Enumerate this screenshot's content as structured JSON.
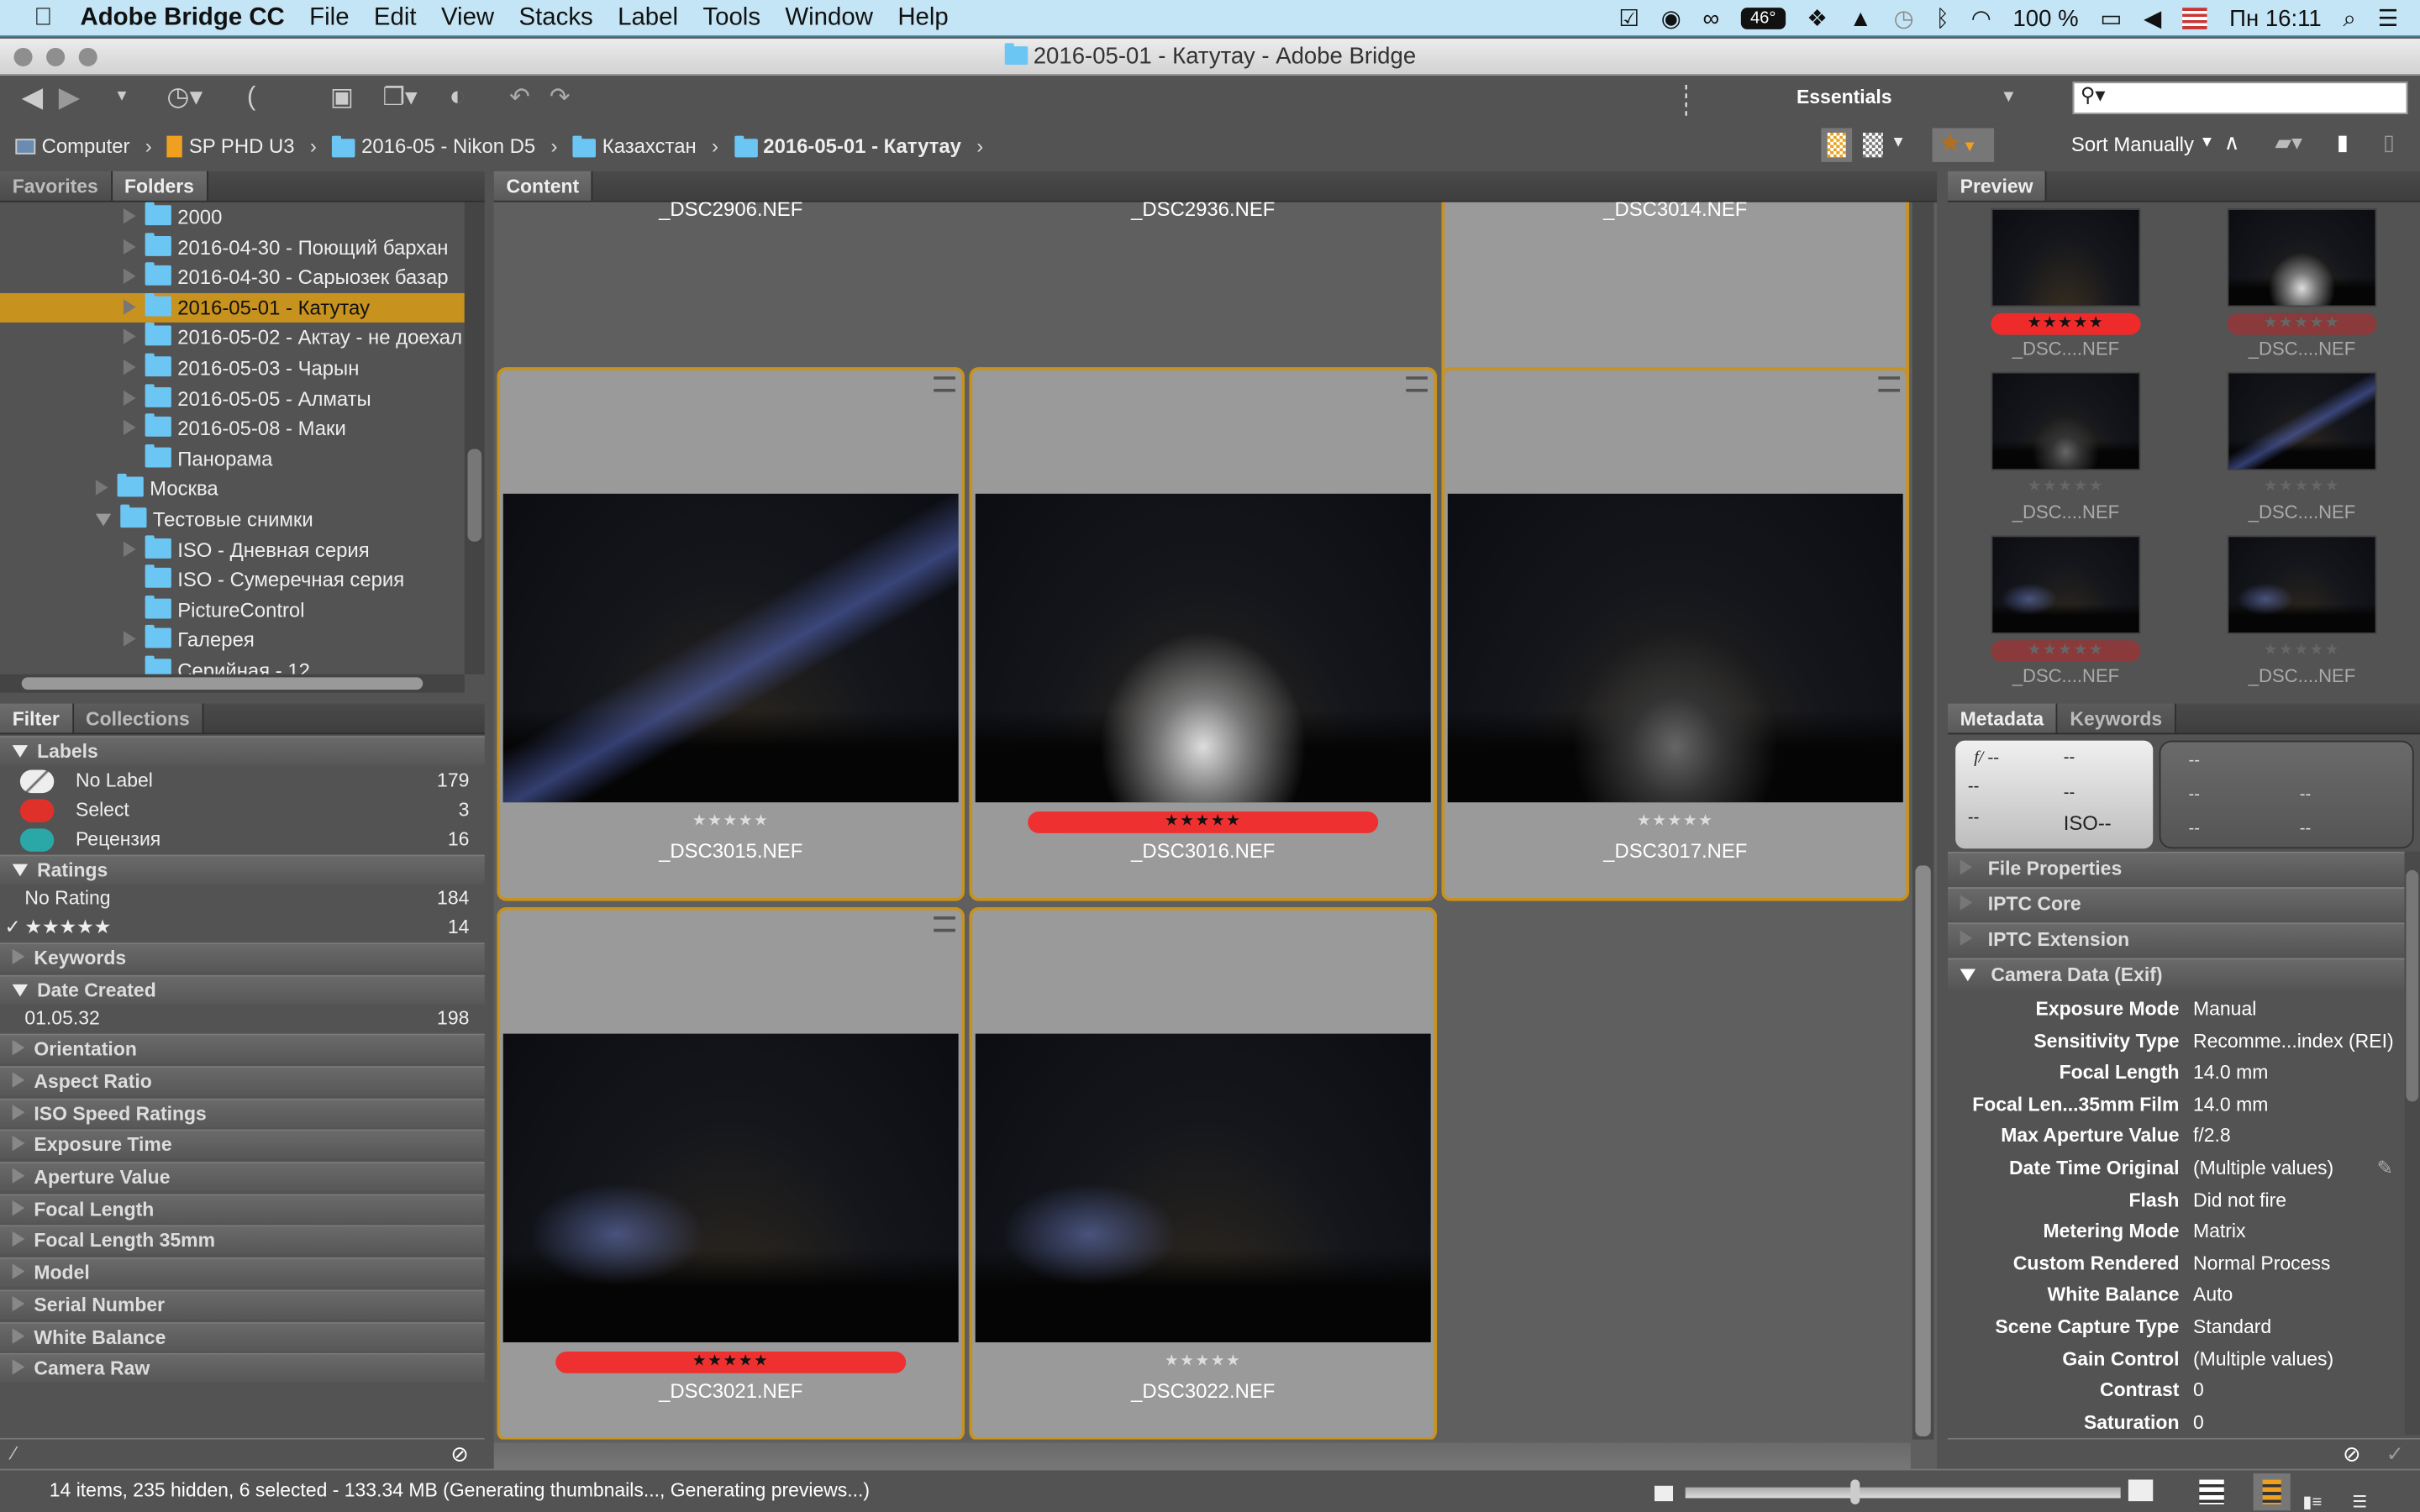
{
  "menubar": {
    "app": "Adobe Bridge CC",
    "items": [
      "File",
      "Edit",
      "View",
      "Stacks",
      "Label",
      "Tools",
      "Window",
      "Help"
    ],
    "temp": "46°",
    "battery": "100 %",
    "clock": "Пн 16:11"
  },
  "window": {
    "title": "2016-05-01 - Катутау - Adobe Bridge"
  },
  "toolbar": {
    "workspace": "Essentials",
    "search_placeholder": "",
    "sort": "Sort Manually"
  },
  "breadcrumb": [
    "Computer",
    "SP PHD U3",
    "2016-05 - Nikon D5",
    "Казахстан",
    "2016-05-01 - Катутау"
  ],
  "left": {
    "tabs": [
      "Favorites",
      "Folders"
    ],
    "folders": [
      {
        "label": "2000",
        "indent": 2,
        "arrow": "right"
      },
      {
        "label": "2016-04-30 - Поющий бархан",
        "indent": 2,
        "arrow": "right"
      },
      {
        "label": "2016-04-30 - Сарыозек базар",
        "indent": 2,
        "arrow": "right"
      },
      {
        "label": "2016-05-01 - Катутау",
        "indent": 2,
        "arrow": "right",
        "selected": true
      },
      {
        "label": "2016-05-02 - Актау - не доехал",
        "indent": 2,
        "arrow": "right"
      },
      {
        "label": "2016-05-03 - Чарын",
        "indent": 2,
        "arrow": "right"
      },
      {
        "label": "2016-05-05 - Алматы",
        "indent": 2,
        "arrow": "right"
      },
      {
        "label": "2016-05-08 - Маки",
        "indent": 2,
        "arrow": "right"
      },
      {
        "label": "Панорама",
        "indent": 2,
        "arrow": "none"
      },
      {
        "label": "Москва",
        "indent": 1,
        "arrow": "right"
      },
      {
        "label": "Тестовые снимки",
        "indent": 1,
        "arrow": "down"
      },
      {
        "label": "ISO - Дневная серия",
        "indent": 2,
        "arrow": "right"
      },
      {
        "label": "ISO - Сумеречная серия",
        "indent": 2,
        "arrow": "none"
      },
      {
        "label": "PictureControl",
        "indent": 2,
        "arrow": "none"
      },
      {
        "label": "Галерея",
        "indent": 2,
        "arrow": "right"
      },
      {
        "label": "Серийная - 12",
        "indent": 2,
        "arrow": "none"
      }
    ]
  },
  "filter": {
    "tabs": [
      "Filter",
      "Collections"
    ],
    "sections": [
      {
        "title": "Labels",
        "open": true,
        "items": [
          {
            "label": "No Label",
            "count": "179",
            "swatch": "none"
          },
          {
            "label": "Select",
            "count": "3",
            "swatch": "#e0302a"
          },
          {
            "label": "Рецензия",
            "count": "16",
            "swatch": "#2aa8a8"
          }
        ]
      },
      {
        "title": "Ratings",
        "open": true,
        "items": [
          {
            "label": "No Rating",
            "count": "184"
          },
          {
            "label": "★★★★★",
            "count": "14",
            "checked": true
          }
        ]
      },
      {
        "title": "Keywords",
        "open": false,
        "items": []
      },
      {
        "title": "Date Created",
        "open": true,
        "items": [
          {
            "label": "01.05.32",
            "count": "198"
          }
        ]
      },
      {
        "title": "Orientation",
        "open": false,
        "items": []
      },
      {
        "title": "Aspect Ratio",
        "open": false,
        "items": []
      },
      {
        "title": "ISO Speed Ratings",
        "open": false,
        "items": []
      },
      {
        "title": "Exposure Time",
        "open": false,
        "items": []
      },
      {
        "title": "Aperture Value",
        "open": false,
        "items": []
      },
      {
        "title": "Focal Length",
        "open": false,
        "items": []
      },
      {
        "title": "Focal Length 35mm",
        "open": false,
        "items": []
      },
      {
        "title": "Model",
        "open": false,
        "items": []
      },
      {
        "title": "Serial Number",
        "open": false,
        "items": []
      },
      {
        "title": "White Balance",
        "open": false,
        "items": []
      },
      {
        "title": "Camera Raw",
        "open": false,
        "items": []
      }
    ]
  },
  "content": {
    "tab": "Content",
    "items": [
      {
        "name": "_DSC2906.NEF",
        "label": "none",
        "stars": "★★★★★",
        "selected": false,
        "scene": "rock"
      },
      {
        "name": "_DSC2936.NEF",
        "label": "#4fc7d8",
        "stars": "★★★★★",
        "selected": false,
        "scene": "brown"
      },
      {
        "name": "_DSC3014.NEF",
        "label": "#ee3030",
        "stars": "★★★★★",
        "selected": true,
        "scene": "dark"
      },
      {
        "name": "_DSC3015.NEF",
        "label": "none",
        "stars": "★★★★★",
        "selected": true,
        "scene": "beam"
      },
      {
        "name": "_DSC3016.NEF",
        "label": "#ee3030",
        "stars": "★★★★★",
        "selected": true,
        "scene": "lit"
      },
      {
        "name": "_DSC3017.NEF",
        "label": "none",
        "stars": "★★★★★",
        "selected": true,
        "scene": "dim"
      },
      {
        "name": "_DSC3021.NEF",
        "label": "#ee3030",
        "stars": "★★★★★",
        "selected": true,
        "scene": "beam2"
      },
      {
        "name": "_DSC3022.NEF",
        "label": "none",
        "stars": "★★★★★",
        "selected": true,
        "scene": "beam2"
      }
    ]
  },
  "preview": {
    "tab": "Preview",
    "items": [
      {
        "name": "_DSC....NEF",
        "label": "#ee2a2a",
        "stars": "★★★★★",
        "scene": "dark"
      },
      {
        "name": "_DSC....NEF",
        "label": "#8a3a3a",
        "stars": "★★★★★",
        "scene": "lit"
      },
      {
        "name": "_DSC....NEF",
        "label": "none",
        "stars": "★★★★★",
        "scene": "dim"
      },
      {
        "name": "_DSC....NEF",
        "label": "none",
        "stars": "★★★★★",
        "scene": "beam"
      },
      {
        "name": "_DSC....NEF",
        "label": "#8a3a3a",
        "stars": "★★★★★",
        "scene": "beam2"
      },
      {
        "name": "_DSC....NEF",
        "label": "none",
        "stars": "★★★★★",
        "scene": "beam2"
      }
    ]
  },
  "metadata": {
    "tabs": [
      "Metadata",
      "Keywords"
    ],
    "placard": {
      "aperture": "f/ --",
      "shutter": "--",
      "a": "--",
      "b": "--",
      "c": "--",
      "iso": "ISO--",
      "r1": "--",
      "r2": "--",
      "r3": "--",
      "r4": "--",
      "r5": "--"
    },
    "sections": [
      "File Properties",
      "IPTC Core",
      "IPTC Extension",
      "Camera Data (Exif)"
    ],
    "rows": [
      {
        "k": "Exposure Mode",
        "v": "Manual"
      },
      {
        "k": "Sensitivity Type",
        "v": "Recomme...index (REI)"
      },
      {
        "k": "Focal Length",
        "v": "14.0 mm"
      },
      {
        "k": "Focal Len...35mm Film",
        "v": "14.0 mm"
      },
      {
        "k": "Max Aperture Value",
        "v": "f/2.8"
      },
      {
        "k": "Date Time Original",
        "v": "(Multiple values)"
      },
      {
        "k": "Flash",
        "v": "Did not fire"
      },
      {
        "k": "Metering Mode",
        "v": "Matrix"
      },
      {
        "k": "Custom Rendered",
        "v": "Normal Process"
      },
      {
        "k": "White Balance",
        "v": "Auto"
      },
      {
        "k": "Scene Capture Type",
        "v": "Standard"
      },
      {
        "k": "Gain Control",
        "v": "(Multiple values)"
      },
      {
        "k": "Contrast",
        "v": "0"
      },
      {
        "k": "Saturation",
        "v": "0"
      }
    ]
  },
  "status": {
    "text": "14 items, 235 hidden, 6 selected - 133.34 MB (Generating thumbnails..., Generating previews...)",
    "thumb_size": 0.38
  },
  "colors": {
    "accent": "#c8921e",
    "folder": "#6cc6f3"
  }
}
